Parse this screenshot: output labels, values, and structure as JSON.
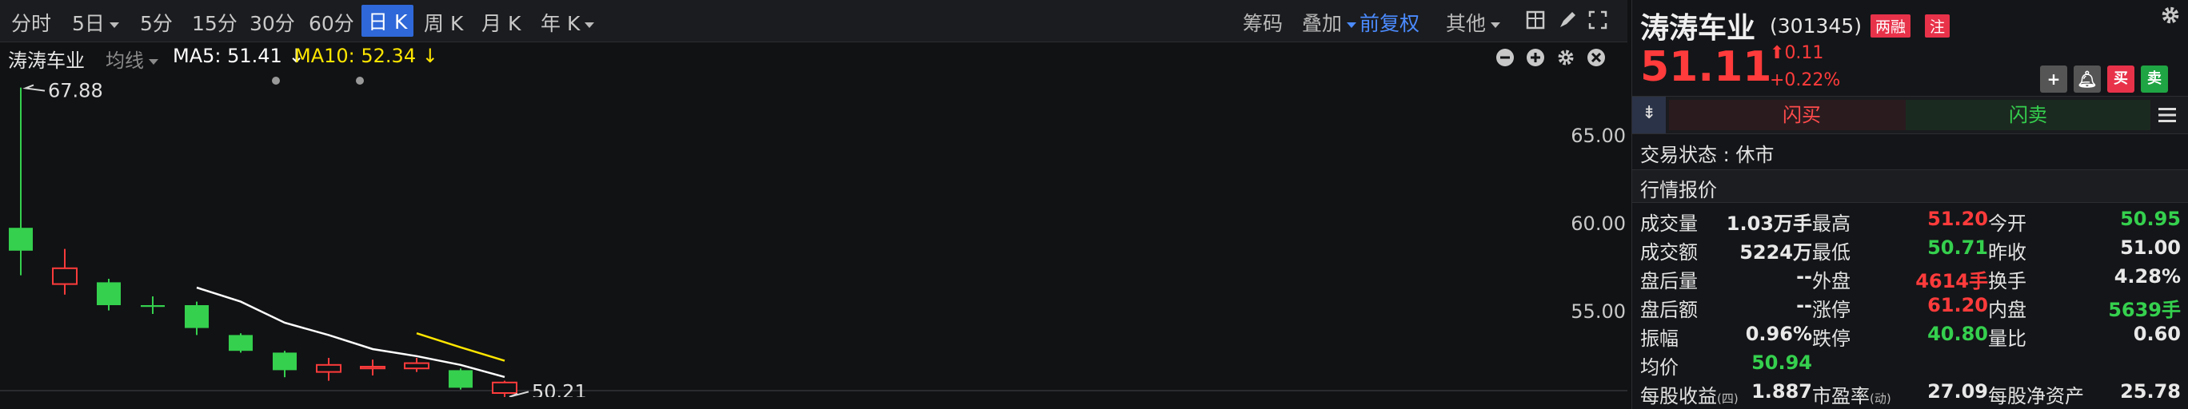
{
  "toolbar": {
    "periods": [
      {
        "label": "分时"
      },
      {
        "label": "5日",
        "dropdown": true
      },
      {
        "label": "5分"
      },
      {
        "label": "15分"
      },
      {
        "label": "30分"
      },
      {
        "label": "60分"
      },
      {
        "label": "日 K",
        "active": true
      },
      {
        "label": "周 K"
      },
      {
        "label": "月 K"
      },
      {
        "label": "年 K",
        "dropdown": true
      }
    ],
    "right_items": {
      "chip": "筹码",
      "overlay": "叠加",
      "adjust": "前复权",
      "other": "其他"
    }
  },
  "chart_header": {
    "stock_name": "涛涛车业",
    "indicator": "均线",
    "ma5_label": "MA5: 51.41 ↓",
    "ma10_label": "MA10: 52.34 ↓",
    "ma5_color": "#ffffff",
    "ma10_color": "#ffe600"
  },
  "chart_data": {
    "type": "candlestick",
    "y_ticks": [
      "65.00",
      "60.00",
      "55.00"
    ],
    "high_annotation": "67.88",
    "low_annotation": "50.21",
    "up_color": "#ff3b3b",
    "down_color": "#35d04e",
    "candles": [
      {
        "open": 59.9,
        "close": 58.6,
        "high": 67.88,
        "low": 57.2
      },
      {
        "open": 56.7,
        "close": 57.6,
        "high": 58.7,
        "low": 56.1
      },
      {
        "open": 56.8,
        "close": 55.5,
        "high": 57.0,
        "low": 55.2
      },
      {
        "open": 55.5,
        "close": 55.4,
        "high": 56.0,
        "low": 55.0
      },
      {
        "open": 55.5,
        "close": 54.2,
        "high": 55.7,
        "low": 53.8
      },
      {
        "open": 53.8,
        "close": 52.9,
        "high": 53.9,
        "low": 52.8
      },
      {
        "open": 52.8,
        "close": 51.8,
        "high": 52.9,
        "low": 51.4
      },
      {
        "open": 51.7,
        "close": 52.1,
        "high": 52.5,
        "low": 51.2
      },
      {
        "open": 51.9,
        "close": 52.0,
        "high": 52.4,
        "low": 51.5
      },
      {
        "open": 51.9,
        "close": 52.2,
        "high": 52.5,
        "low": 51.7
      },
      {
        "open": 51.8,
        "close": 50.8,
        "high": 51.9,
        "low": 50.7
      },
      {
        "open": 50.5,
        "close": 51.1,
        "high": 51.2,
        "low": 50.21
      }
    ],
    "ma5": [
      null,
      null,
      null,
      null,
      56.5,
      55.7,
      54.5,
      53.8,
      53.0,
      52.6,
      52.1,
      51.41
    ],
    "ma10": [
      null,
      null,
      null,
      null,
      null,
      null,
      null,
      null,
      null,
      53.9,
      53.1,
      52.34
    ]
  },
  "stock": {
    "name": "涛涛车业",
    "code": "(301345)",
    "badge1": "两融",
    "badge2": "注",
    "price": "51.11",
    "change": "0.11",
    "change_pct": "+0.22%",
    "btn_buy": "买",
    "btn_sell": "卖"
  },
  "flash": {
    "buy": "闪买",
    "sell": "闪卖"
  },
  "status": "交易状态 : 休市",
  "quote_title": "行情报价",
  "quotes": [
    [
      {
        "l": "成交量",
        "v": "1.03万手",
        "c": "w"
      },
      {
        "l": "最高",
        "v": "51.20",
        "c": "r"
      },
      {
        "l": "今开",
        "v": "50.95",
        "c": "g"
      }
    ],
    [
      {
        "l": "成交额",
        "v": "5224万",
        "c": "w"
      },
      {
        "l": "最低",
        "v": "50.71",
        "c": "g"
      },
      {
        "l": "昨收",
        "v": "51.00",
        "c": "w"
      }
    ],
    [
      {
        "l": "盘后量",
        "v": "--",
        "c": "w"
      },
      {
        "l": "外盘",
        "v": "4614手",
        "c": "r"
      },
      {
        "l": "换手",
        "v": "4.28%",
        "c": "w"
      }
    ],
    [
      {
        "l": "盘后额",
        "v": "--",
        "c": "w"
      },
      {
        "l": "涨停",
        "v": "61.20",
        "c": "r"
      },
      {
        "l": "内盘",
        "v": "5639手",
        "c": "g"
      }
    ],
    [
      {
        "l": "振幅",
        "v": "0.96%",
        "c": "w"
      },
      {
        "l": "跌停",
        "v": "40.80",
        "c": "g"
      },
      {
        "l": "量比",
        "v": "0.60",
        "c": "w"
      }
    ],
    [
      {
        "l": "均价",
        "v": "50.94",
        "c": "g"
      }
    ],
    [
      {
        "l": "每股收益",
        "sub": "(四)",
        "v": "1.887",
        "c": "w"
      },
      {
        "l": "市盈率",
        "sub": "(动)",
        "v": "27.09",
        "c": "w"
      },
      {
        "l": "每股净资产",
        "v": "25.78",
        "c": "w"
      }
    ]
  ]
}
